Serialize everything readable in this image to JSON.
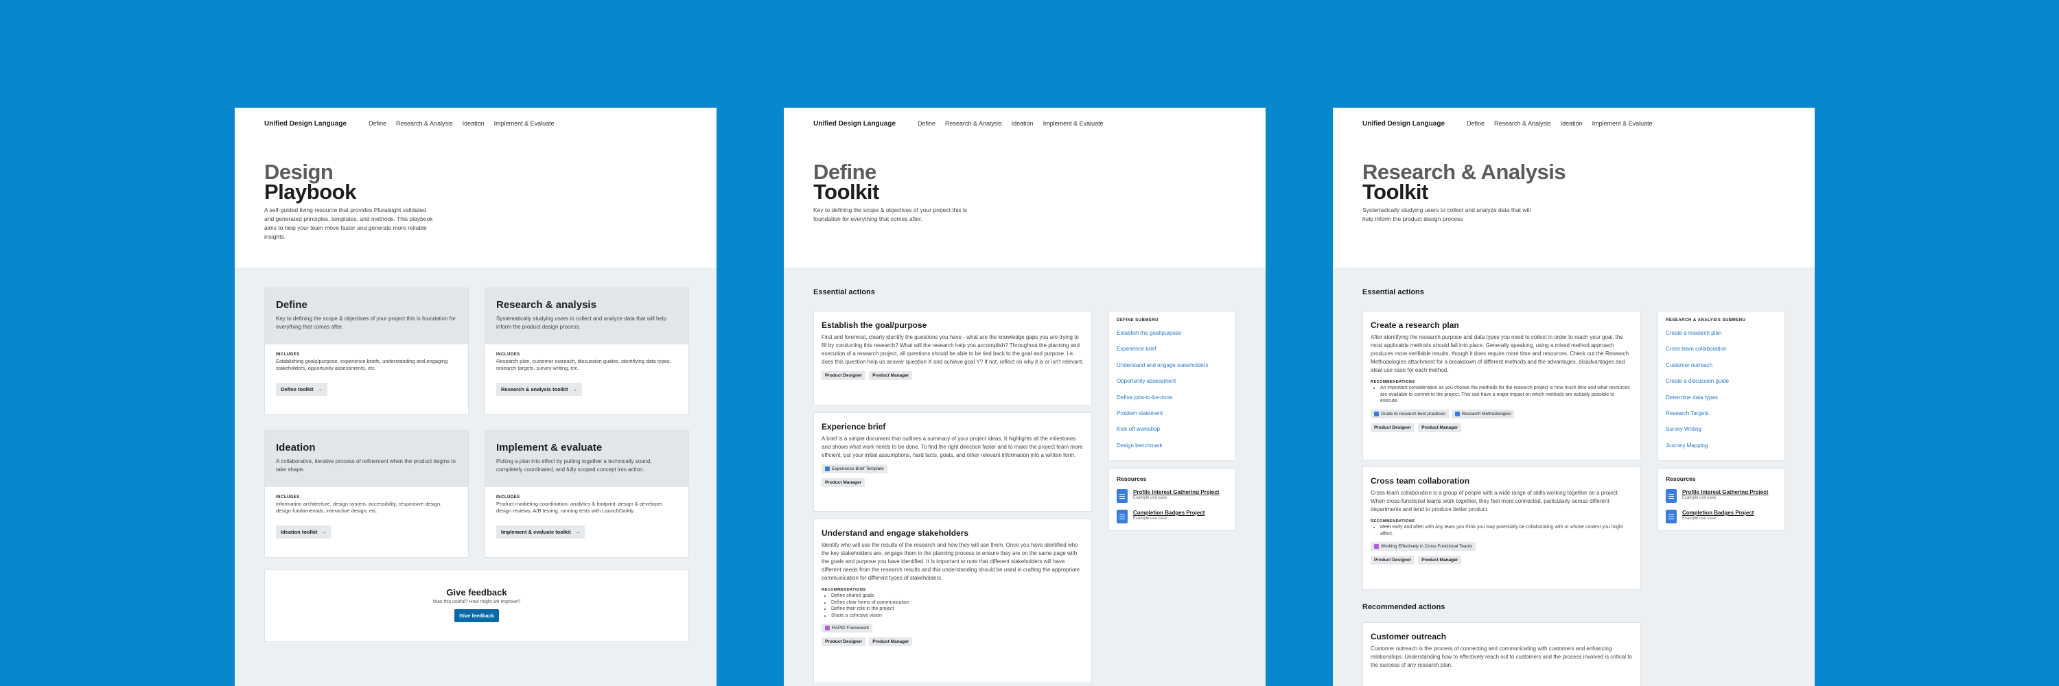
{
  "nav": {
    "brand": "Unified Design Language",
    "links": [
      "Define",
      "Research & Analysis",
      "Ideation",
      "Implement & Evaluate"
    ]
  },
  "playbook": {
    "title_l1": "Design",
    "title_l2": "Playbook",
    "description": "A self-guided living resource that provides Pluralsight validated and generated principles, templates, and methods. This playbook aims to help your team move faster and generate more reliable insights.",
    "cards": [
      {
        "title": "Define",
        "desc": "Key to defining the scope & objectives of your project this is foundation for everything that comes after.",
        "includes_label": "INCLUDES",
        "includes": "Establishing goals/purpose, experience briefs, understanding and engaging stakeholders, opportunity assessments, etc.",
        "button": "Define toolkit"
      },
      {
        "title": "Research & analysis",
        "desc": "Systematically studying users to collect and analyze data that will help inform the product design process.",
        "includes_label": "INCLUDES",
        "includes": "Research plan, customer outreach, discussion guides, identifying data types, research targets, survey writing, etc.",
        "button": "Research & analysis toolkit"
      },
      {
        "title": "Ideation",
        "desc": "A collaborative, iterative process of refinement when the product begins to take shape.",
        "includes_label": "INCLUDES",
        "includes": "Information architecture, design system, accessibility, responsive design, design fundamentals, interactive design, etc.",
        "button": "Ideation toolkit"
      },
      {
        "title": "Implement & evaluate",
        "desc": "Putting a plan into effect by putting together a technically sound, completely coordinated, and fully scoped concept into action.",
        "includes_label": "INCLUDES",
        "includes": "Product marketing coordination, analytics & footprint, design & developer design reviews, A/B testing, running tests with LaunchDarkly",
        "button": "Implement & evaluate toolkit"
      }
    ],
    "feedback": {
      "title": "Give feedback",
      "subtitle": "Was this useful? How might we improve?",
      "button": "Give feedback"
    }
  },
  "define": {
    "title_l1": "Define",
    "title_l2": "Toolkit",
    "description": "Key to defining the scope & objectives of your project this is foundation for everything that comes after.",
    "section": "Essential actions",
    "cards": [
      {
        "title": "Establish the goal/purpose",
        "desc": "First and foremost, clearly identify the questions you have - what are the knowledge gaps you are trying to fill by conducting this research? What will the research help you accomplish? Throughout the planning and execution of a research project, all questions should be able to be tied back to the goal and purpose. i.e. does this question help us answer question X and achieve goal Y? If not, reflect on why it is or isn't relevant.",
        "tags": [
          "Product Designer",
          "Product Manager"
        ]
      },
      {
        "title": "Experience brief",
        "desc": "A brief is a simple document that outlines a summary of your project ideas. It highlights all the milestones and shows what work needs to be done. To find the right direction faster and to make the project team more efficient, put your initial assumptions, hard facts, goals, and other relevant information into a written form.",
        "resource": "Experience Brief Template",
        "tags": [
          "Product Manager"
        ]
      },
      {
        "title": "Understand and engage stakeholders",
        "desc": "Identify who will use the results of the research and how they will use them. Once you have identified who the key stakeholders are, engage them in the planning process to ensure they are on the same page with the goals and purpose you have identified. It is important to note that different stakeholders will have different needs from the research results and this understanding should be used in crafting the appropriate communication for different types of stakeholders.",
        "rec_label": "RECOMMENDATIONS",
        "bullets": [
          "Define shared goals",
          "Define clear forms of communication",
          "Define their role in the project",
          "Share a cohesive vision"
        ],
        "resource": "RAPID Framework",
        "tags": [
          "Product Designer",
          "Product Manager"
        ]
      }
    ],
    "submenu": {
      "heading": "DEFINE SUBMENU",
      "items": [
        "Establish the goal/purpose",
        "Experience brief",
        "Understand and engage stakeholders",
        "Opportunity assessment",
        "Define jobs-to-be-done",
        "Problem statement",
        "Kick-off workshop",
        "Design benchmark"
      ]
    },
    "resources": {
      "heading": "Resources",
      "items": [
        {
          "title": "Profile Interest Gathering Project",
          "sub": "Example use case"
        },
        {
          "title": "Completion Badges Project",
          "sub": "Example use case"
        }
      ]
    }
  },
  "research": {
    "title_l1": "Research & Analysis",
    "title_l2": "Toolkit",
    "description": "Systematically studying users to collect and analyze data that will help inform the product design process",
    "section": "Essential actions",
    "section2": "Recommended actions",
    "cards": [
      {
        "title": "Create a research plan",
        "desc": "After identifying the research purpose and data types you need to collect in order to reach your goal, the most applicable methods should fall into place. Generally speaking, using a mixed method approach produces more verifiable results, though it does require more time and resources. Check out the Research Methodologies attachment for a breakdown of different methods and the advantages, disadvantages and ideal use case for each method.",
        "rec_label": "RECOMMENDATIONS",
        "bullets": [
          "An important consideration as you choose the methods for the research project is how much time and what resources are available to commit to the project. This can have a major impact on which methods are actually possible to execute."
        ],
        "resources": [
          "Guide to research best practices",
          "Research Methodologies"
        ],
        "tags": [
          "Product Designer",
          "Product Manager"
        ]
      },
      {
        "title": "Cross team collaboration",
        "desc": "Cross-team collaboration is a group of people with a wide range of skills working together on a project. When cross-functional teams work together, they feel more connected, particularly across different departments and tend to produce better product.",
        "rec_label": "RECOMMENDATIONS",
        "bullets": [
          "Meet early and often with any team you think you may potentially be collaborating with or whose context you might affect."
        ],
        "resources": [
          "Working Effectively in Cross Functional Teams"
        ],
        "tags": [
          "Product Designer",
          "Product Manager"
        ]
      },
      {
        "title": "Customer outreach",
        "desc": "Customer outreach is the process of connecting and communicating with customers and enhancing relationships. Understanding how to effectively reach out to customers and the process involved is critical to the success of any research plan."
      }
    ],
    "submenu": {
      "heading": "RESEARCH & ANALYSIS SUBMENU",
      "items": [
        "Create a research plan",
        "Cross team collaboration",
        "Customer outreach",
        "Create a discussion guide",
        "Determine data types",
        "Research Targets",
        "Survey Writing",
        "Journey Mapping"
      ]
    },
    "resources": {
      "heading": "Resources",
      "items": [
        {
          "title": "Profile Interest Gathering Project",
          "sub": "Example use case"
        },
        {
          "title": "Completion Badges Project",
          "sub": "Example use case"
        }
      ]
    }
  },
  "colors": {
    "background": "#0787cd",
    "link": "#2878c4",
    "button": "#0a6aa8"
  }
}
